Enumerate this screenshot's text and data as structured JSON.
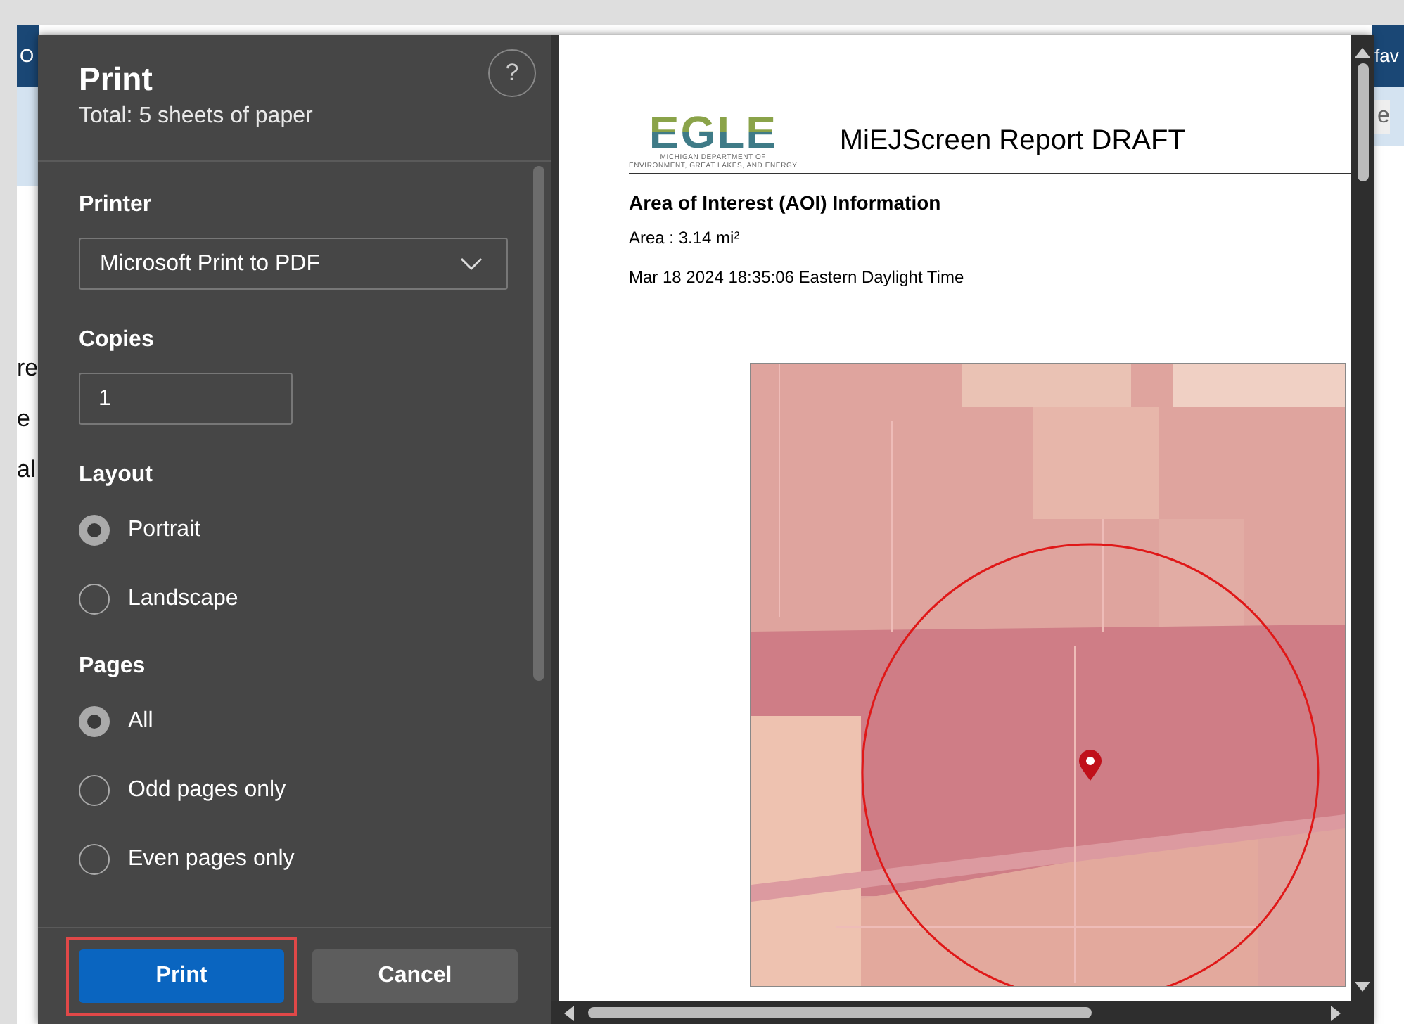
{
  "background_page": {
    "left_fragments": [
      "O",
      "re",
      "e",
      "al"
    ],
    "right_fragments": [
      "fav",
      "e"
    ]
  },
  "print_panel": {
    "title": "Print",
    "subtitle": "Total: 5 sheets of paper",
    "help": "?",
    "sections": [
      {
        "kind": "select",
        "label": "Printer",
        "value": "Microsoft Print to PDF"
      },
      {
        "kind": "input",
        "label": "Copies",
        "value": "1"
      },
      {
        "kind": "radio",
        "label": "Layout",
        "options": [
          {
            "label": "Portrait",
            "selected": true
          },
          {
            "label": "Landscape",
            "selected": false
          }
        ]
      },
      {
        "kind": "radio",
        "label": "Pages",
        "options": [
          {
            "label": "All",
            "selected": true
          },
          {
            "label": "Odd pages only",
            "selected": false
          },
          {
            "label": "Even pages only",
            "selected": false
          }
        ]
      }
    ]
  },
  "buttons": [
    {
      "label": "Print",
      "kind": "primary",
      "highlighted": true
    },
    {
      "label": "Cancel",
      "kind": "secondary",
      "highlighted": false
    }
  ],
  "preview": {
    "logo": {
      "wordmark": "EGLE",
      "tagline_1": "MICHIGAN DEPARTMENT OF",
      "tagline_2": "ENVIRONMENT, GREAT LAKES, AND ENERGY"
    },
    "title": "MiEJScreen Report DRAFT",
    "heading": "Area of Interest (AOI) Information",
    "area": "Area : 3.14 mi²",
    "timestamp": "Mar 18 2024 18:35:06 Eastern Daylight Time"
  }
}
